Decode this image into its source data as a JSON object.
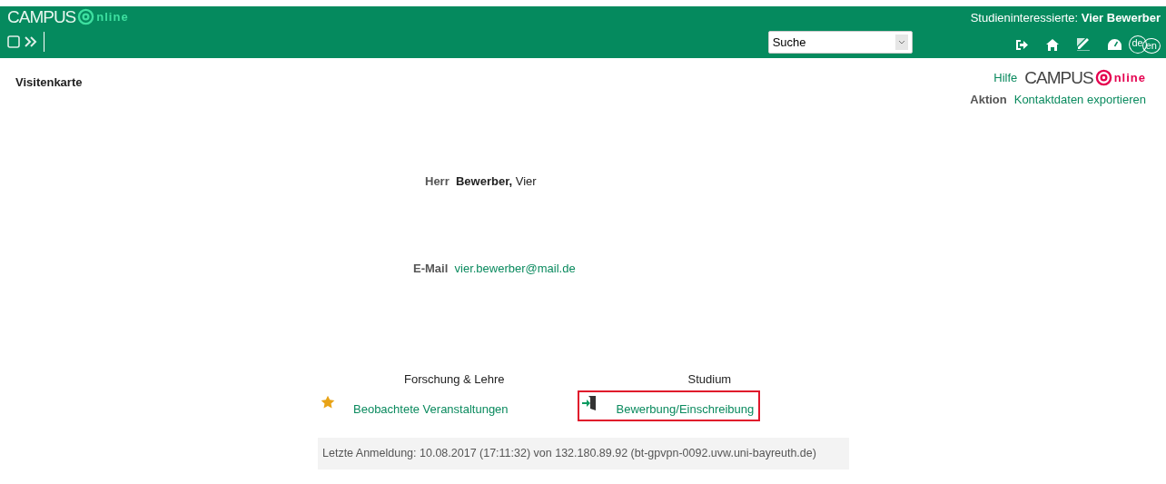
{
  "header": {
    "logo": {
      "brand": "CAMPUS",
      "suffix": "nline"
    },
    "user_role": "Studieninteressierte:",
    "user_name": "Vier Bewerber",
    "search": {
      "value": "Suche"
    },
    "language_toggle": [
      "de",
      "en"
    ]
  },
  "page_title": "Visitenkarte",
  "help_link": "Hilfe",
  "help_logo": {
    "brand": "CAMPUS",
    "suffix": "nline"
  },
  "action": {
    "label": "Aktion",
    "link": "Kontaktdaten exportieren"
  },
  "person": {
    "salutation": "Herr",
    "surname": "Bewerber,",
    "given_name": "Vier"
  },
  "email": {
    "label": "E-Mail",
    "value": "vier.bewerber@mail.de"
  },
  "sections": [
    {
      "title": "Forschung & Lehre",
      "link": "Beobachtete Veranstaltungen",
      "kind": "star",
      "highlighted": false
    },
    {
      "title": "Studium",
      "link": "Bewerbung/Einschreibung",
      "kind": "door",
      "highlighted": true
    }
  ],
  "last_login": "Letzte Anmeldung: 10.08.2017 (17:11:32) von 132.180.89.92 (bt-gpvpn-0092.uvw.uni-bayreuth.de)"
}
